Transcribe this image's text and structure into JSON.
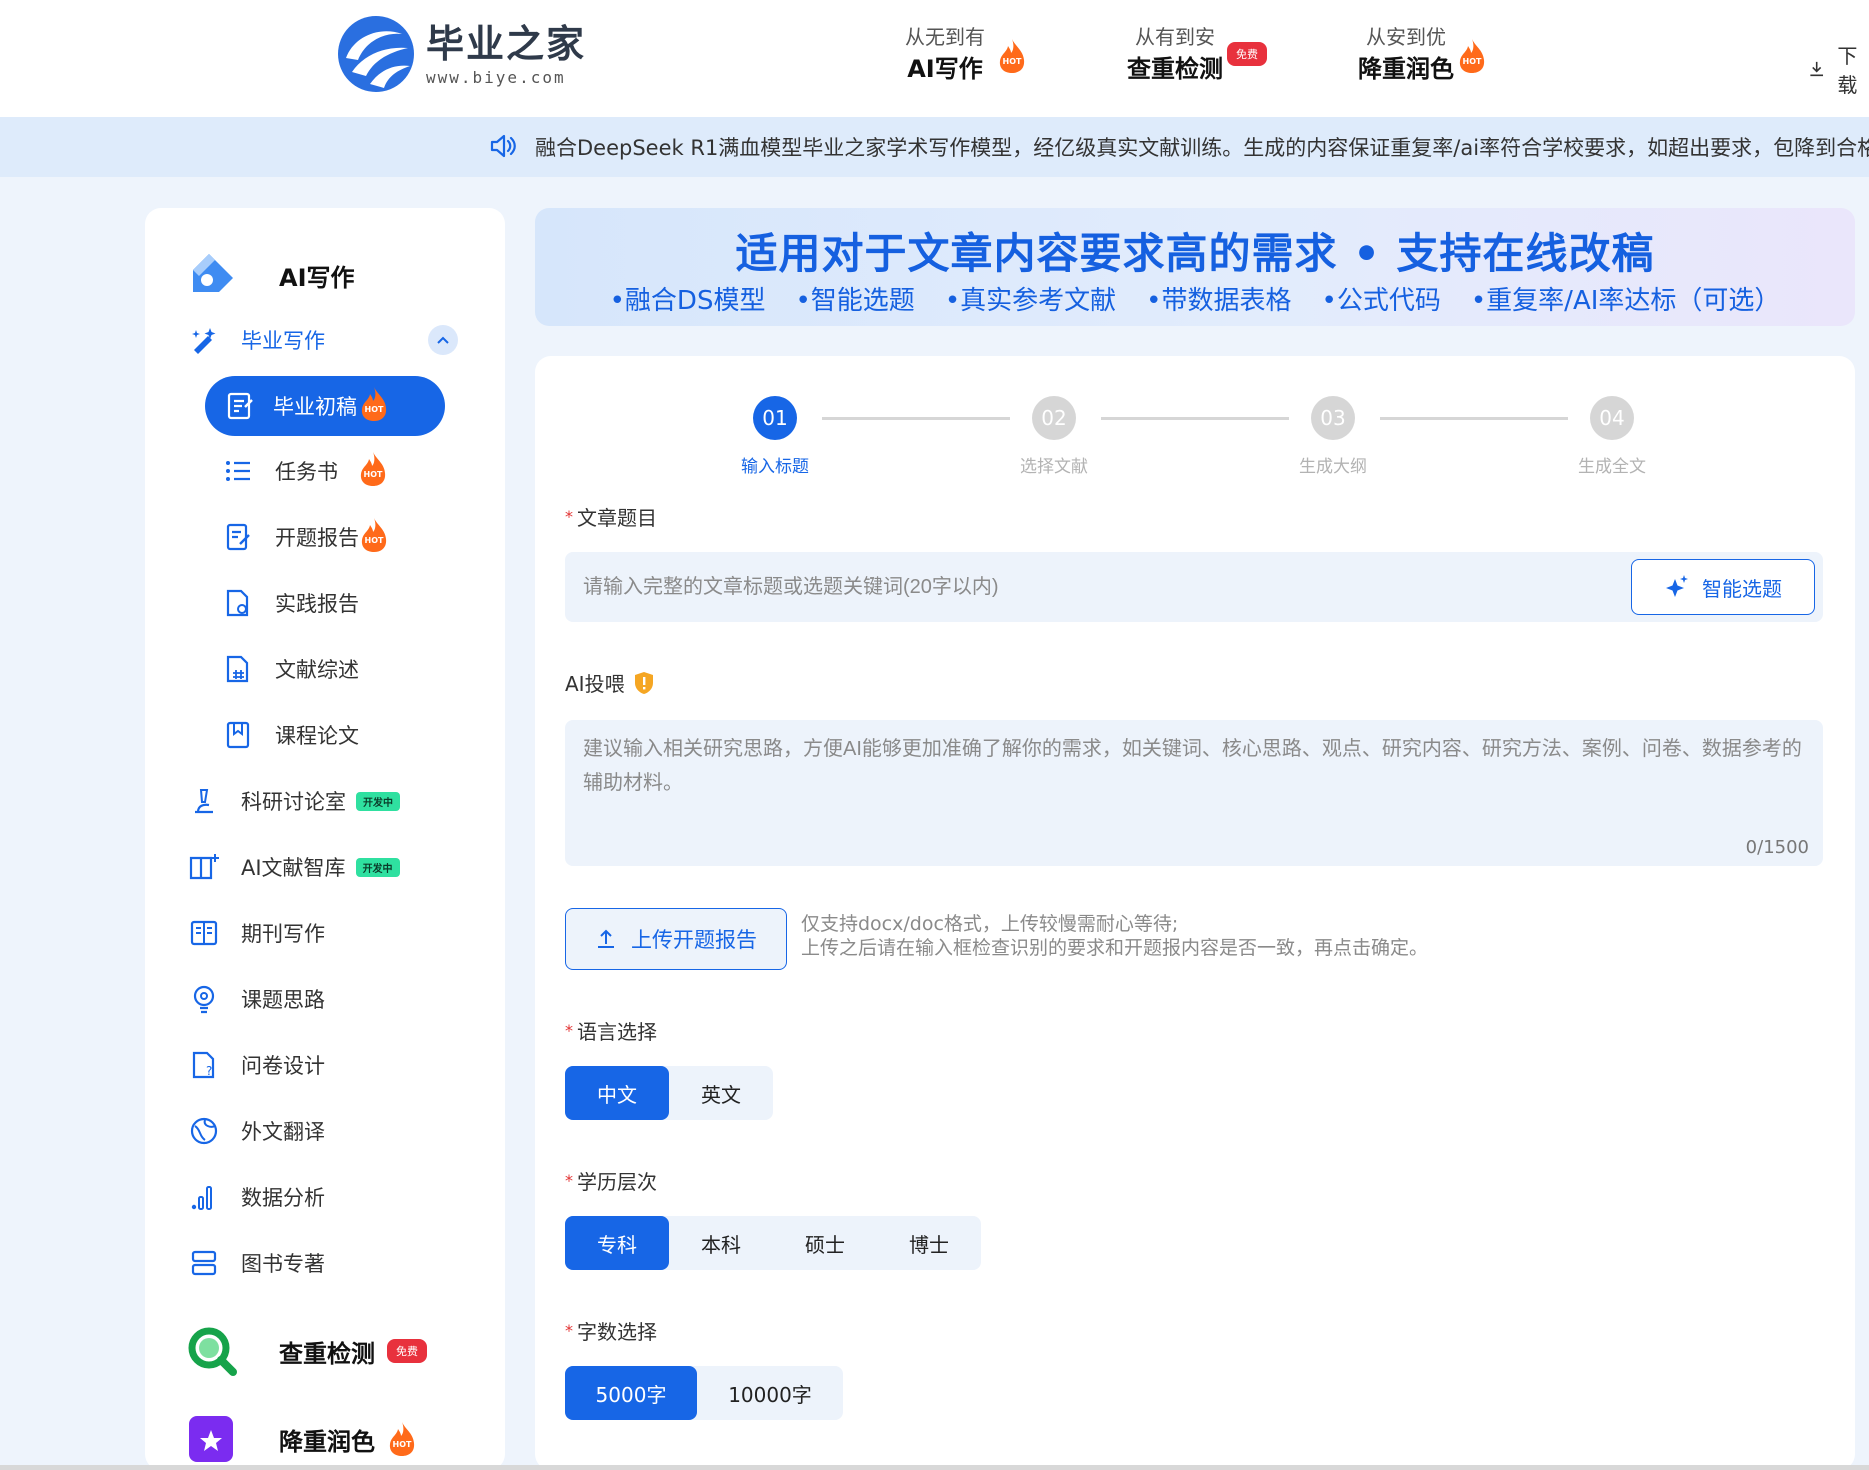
{
  "header": {
    "logo_name": "毕业之家",
    "logo_url": "www.biye.com",
    "nav": [
      {
        "sub": "从无到有",
        "main": "AI写作",
        "badge": "HOT"
      },
      {
        "sub": "从有到安",
        "main": "查重检测",
        "badge": "免费"
      },
      {
        "sub": "从安到优",
        "main": "降重润色",
        "badge": "HOT"
      }
    ],
    "download_label": "下载"
  },
  "notice": {
    "text": "融合DeepSeek R1满血模型毕业之家学术写作模型，经亿级真实文献训练。生成的内容保证重复率/ai率符合学校要求，如超出要求，包降到合格"
  },
  "sidebar": {
    "ai_title": "AI写作",
    "group_label": "毕业写作",
    "active_item": {
      "label": "毕业初稿",
      "badge": "HOT"
    },
    "sub_items": [
      {
        "label": "任务书",
        "badge": "HOT"
      },
      {
        "label": "开题报告",
        "badge": "HOT"
      },
      {
        "label": "实践报告"
      },
      {
        "label": "文献综述"
      },
      {
        "label": "课程论文"
      }
    ],
    "items": [
      {
        "label": "科研讨论室",
        "badge": "开发中"
      },
      {
        "label": "AI文献智库",
        "badge": "开发中"
      },
      {
        "label": "期刊写作"
      },
      {
        "label": "课题思路"
      },
      {
        "label": "问卷设计"
      },
      {
        "label": "外文翻译"
      },
      {
        "label": "数据分析"
      },
      {
        "label": "图书专著"
      }
    ],
    "check_title": "查重检测",
    "check_badge": "免费",
    "polish_title": "降重润色",
    "polish_badge": "HOT"
  },
  "banner": {
    "title": "适用对于文章内容要求高的需求 • 支持在线改稿",
    "features": [
      "•融合DS模型",
      "•智能选题",
      "•真实参考文献",
      "•带数据表格",
      "•公式代码",
      "•重复率/AI率达标（可选）"
    ]
  },
  "steps": [
    {
      "num": "01",
      "label": "输入标题"
    },
    {
      "num": "02",
      "label": "选择文献"
    },
    {
      "num": "03",
      "label": "生成大纲"
    },
    {
      "num": "04",
      "label": "生成全文"
    }
  ],
  "form": {
    "title_label": "文章题目",
    "title_placeholder": "请输入完整的文章标题或选题关键词(20字以内)",
    "smart_button": "智能选题",
    "feed_label": "AI投喂",
    "feed_placeholder": "建议输入相关研究思路，方便AI能够更加准确了解你的需求，如关键词、核心思路、观点、研究内容、研究方法、案例、问卷、数据参考的辅助材料。",
    "feed_count": "0/1500",
    "upload_button": "上传开题报告",
    "upload_hint_1": "仅支持docx/doc格式，上传较慢需耐心等待;",
    "upload_hint_2": "上传之后请在输入框检查识别的要求和开题报内容是否一致，再点击确定。",
    "language_label": "语言选择",
    "languages": [
      "中文",
      "英文"
    ],
    "language_selected": "中文",
    "degree_label": "学历层次",
    "degrees": [
      "专科",
      "本科",
      "硕士",
      "博士"
    ],
    "degree_selected": "专科",
    "words_label": "字数选择",
    "words": [
      "5000字",
      "10000字"
    ],
    "words_selected": "5000字"
  },
  "colors": {
    "primary": "#1766e6",
    "hot": "#ff6a1a",
    "free": "#e8313d",
    "dev": "#2fe0a0"
  }
}
